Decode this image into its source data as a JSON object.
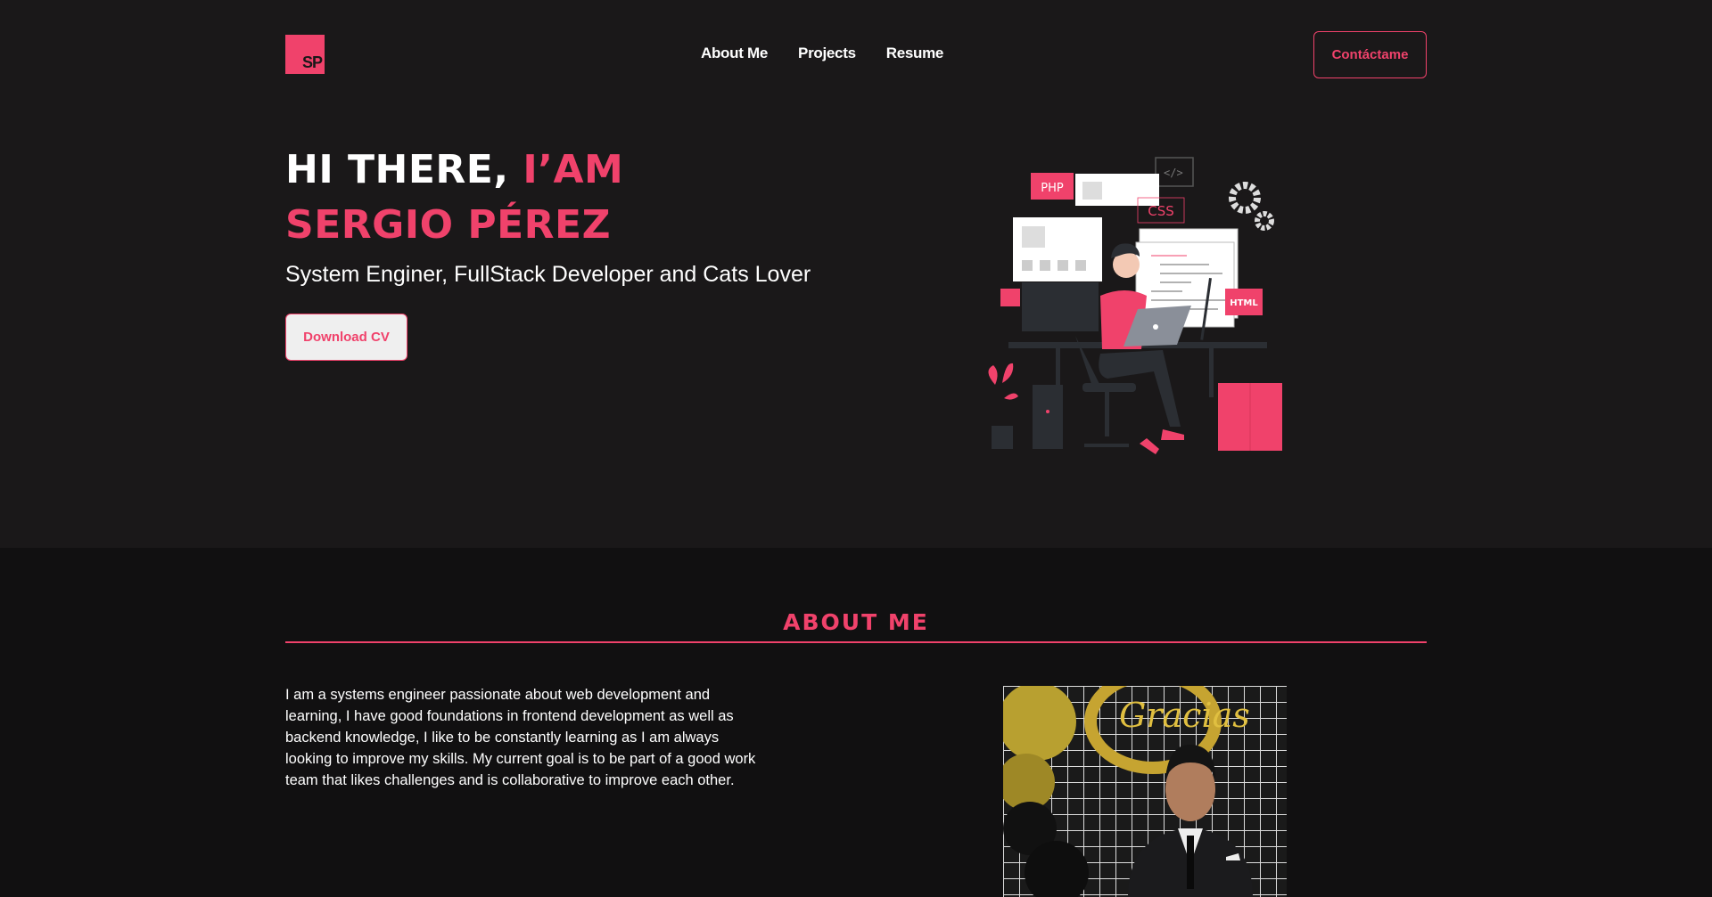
{
  "header": {
    "logo_text": "SP",
    "nav": [
      {
        "label": "About Me"
      },
      {
        "label": "Projects"
      },
      {
        "label": "Resume"
      }
    ],
    "contact_label": "Contáctame"
  },
  "hero": {
    "headline_white": "HI THERE, ",
    "headline_pink_1": "I’AM",
    "headline_pink_2": "SERGIO PÉREZ",
    "subtitle": "System Enginer, FullStack Developer and Cats Lover",
    "cv_label": "Download CV",
    "illustration_labels": {
      "php": "PHP",
      "css": "CSS",
      "html": "HTML"
    }
  },
  "about": {
    "title": "ABOUT ME",
    "text": "I am a systems engineer passionate about web development and learning, I have good foundations in frontend development as well as backend knowledge, I like to be constantly learning as I am always looking to improve my skills. My current goal is to be part of a good work team that likes challenges and is collaborative to improve each other.",
    "photo_sign_text": "Gracias"
  },
  "colors": {
    "accent": "#f0426b",
    "hero_bg": "#1a1819",
    "page_bg": "#111011"
  }
}
